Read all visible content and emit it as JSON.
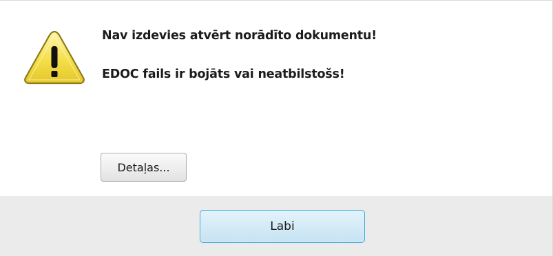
{
  "dialog": {
    "icon": "warning-icon",
    "message_primary": "Nav izdevies atvērt norādīto dokumentu!",
    "message_secondary": "EDOC fails ir bojāts vai neatbilstošs!",
    "details_button_label": "Detaļas...",
    "ok_button_label": "Labi"
  },
  "colors": {
    "warning_fill": "#f2dc45",
    "footer_background": "#ebebeb",
    "default_button_border": "#3fa9d8"
  }
}
